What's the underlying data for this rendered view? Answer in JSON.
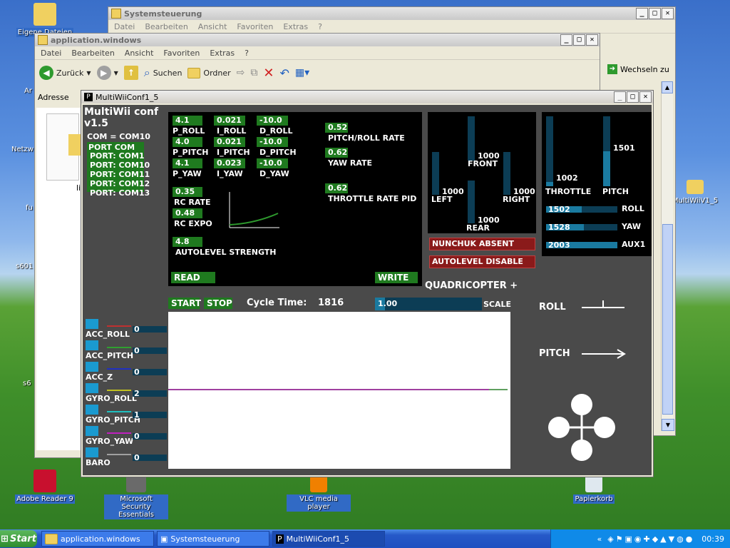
{
  "desktop": {
    "icons": [
      {
        "label": "Eigene Dateien"
      },
      {
        "label": "Adobe Reader 9"
      },
      {
        "label": "Microsoft Security Essentials"
      },
      {
        "label": "VLC media player"
      },
      {
        "label": "Papierkorb"
      },
      {
        "label": "MultiWiiV1_5"
      }
    ],
    "edge_labels": [
      "Ar",
      "Netzw",
      "fu",
      "s601",
      "s6"
    ]
  },
  "systemsteuerung": {
    "title": "Systemsteuerung",
    "menu": [
      "Datei",
      "Bearbeiten",
      "Ansicht",
      "Favoriten",
      "Extras",
      "?"
    ],
    "go_label": "Wechseln zu"
  },
  "explorer": {
    "title": "application.windows",
    "menu": [
      "Datei",
      "Bearbeiten",
      "Ansicht",
      "Favoriten",
      "Extras",
      "?"
    ],
    "back_label": "Zurück",
    "search_label": "Suchen",
    "folders_label": "Ordner",
    "address_label": "Adresse",
    "file_label": "li"
  },
  "multiwii": {
    "title": "MultiWiiConf1_5",
    "header_line1": "MultiWii conf",
    "header_line2": "v1.5",
    "com_status": "COM = COM10",
    "ports": [
      "PORT COM",
      "PORT: COM1",
      "PORT: COM10",
      "PORT: COM11",
      "PORT: COM12",
      "PORT: COM13"
    ],
    "pid": {
      "p_roll": "4.1",
      "i_roll": "0.021",
      "d_roll": "-10.0",
      "p_pitch": "4.0",
      "i_pitch": "0.021",
      "d_pitch": "-10.0",
      "p_yaw": "4.1",
      "i_yaw": "0.023",
      "d_yaw": "-10.0",
      "labels": {
        "p_roll": "P_ROLL",
        "i_roll": "I_ROLL",
        "d_roll": "D_ROLL",
        "p_pitch": "P_PITCH",
        "i_pitch": "I_PITCH",
        "d_pitch": "D_PITCH",
        "p_yaw": "P_YAW",
        "i_yaw": "I_YAW",
        "d_yaw": "D_YAW"
      }
    },
    "rc_rate": {
      "value": "0.35",
      "label": "RC RATE"
    },
    "rc_expo": {
      "value": "0.48",
      "label": "RC EXPO"
    },
    "autolevel": {
      "value": "4.8",
      "label": "AUTOLEVEL STRENGTH"
    },
    "pitch_roll_rate": {
      "value": "0.52",
      "label": "PITCH/ROLL RATE"
    },
    "yaw_rate": {
      "value": "0.62",
      "label": "YAW RATE"
    },
    "throttle_pid": {
      "value": "0.62",
      "label": "THROTTLE RATE PID"
    },
    "read_label": "READ",
    "write_label": "WRITE",
    "motors": {
      "front": {
        "value": "1000",
        "label": "FRONT"
      },
      "left": {
        "value": "1000",
        "label": "LEFT"
      },
      "right": {
        "value": "1000",
        "label": "RIGHT"
      },
      "rear": {
        "value": "1000",
        "label": "REAR"
      }
    },
    "nunchuk_label": "NUNCHUK ABSENT",
    "autolevel_status": "AUTOLEVEL DISABLE",
    "rc": {
      "throttle": {
        "value": "1002",
        "label": "THROTTLE"
      },
      "pitch": {
        "value": "1501",
        "label": "PITCH",
        "level": 0.5
      },
      "roll": {
        "value": "1502",
        "label": "ROLL",
        "level": 0.5
      },
      "yaw": {
        "value": "1528",
        "label": "YAW",
        "level": 0.53
      },
      "aux1": {
        "value": "2003",
        "label": "AUX1",
        "level": 1.0
      }
    },
    "quad_label": "QUADRICOPTER +",
    "start_label": "START",
    "stop_label": "STOP",
    "cycle_label": "Cycle Time:",
    "cycle_value": "1816",
    "scale_value": "1.00",
    "scale_label": "SCALE",
    "roll_indicator": "ROLL",
    "pitch_indicator": "PITCH",
    "sensors": [
      {
        "name": "ACC_ROLL",
        "value": "0",
        "color": "#c03030"
      },
      {
        "name": "ACC_PITCH",
        "value": "0",
        "color": "#30a030"
      },
      {
        "name": "ACC_Z",
        "value": "0",
        "color": "#2030c0"
      },
      {
        "name": "GYRO_ROLL",
        "value": "2",
        "color": "#c0c020"
      },
      {
        "name": "GYRO_PITCH",
        "value": "1",
        "color": "#20c0c0"
      },
      {
        "name": "GYRO_YAW",
        "value": "0",
        "color": "#c020c0"
      },
      {
        "name": "BARO",
        "value": "0",
        "color": "#a0a0a0"
      }
    ]
  },
  "taskbar": {
    "start_label": "Start",
    "tasks": [
      "application.windows",
      "Systemsteuerung",
      "MultiWiiConf1_5"
    ],
    "clock": "00:39"
  }
}
